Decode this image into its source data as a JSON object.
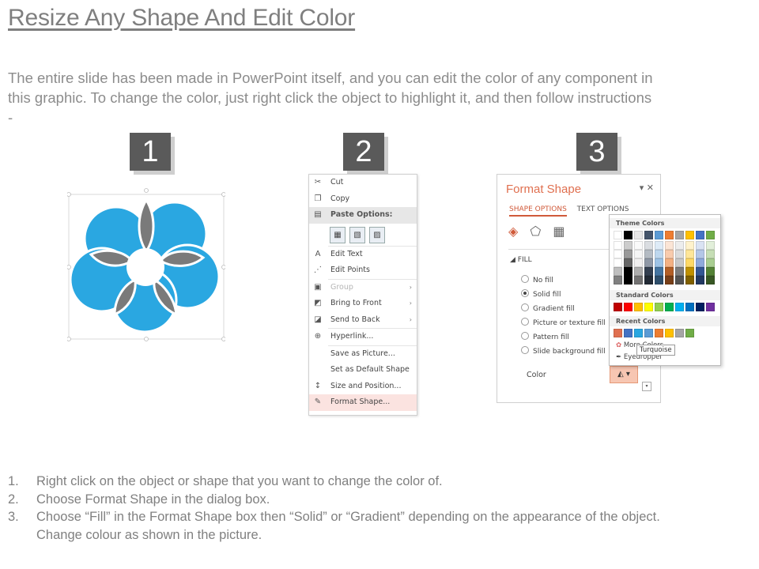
{
  "title": "Resize Any Shape And Edit Color",
  "intro": {
    "line1": "The entire slide has been made in PowerPoint itself, and you can edit the color of any component in",
    "line2": "this graphic. To change the color, just right click the object to highlight it, and then follow instructions",
    "line3": "-"
  },
  "badges": [
    "1",
    "2",
    "3"
  ],
  "colors": {
    "petal": "#2aa7e1",
    "leaf": "#7a7a7a",
    "badge": "#5a5a5a",
    "accent": "#e07050"
  },
  "context_menu": {
    "items": [
      {
        "icon": "scissors-icon",
        "glyph": "✂",
        "label": "Cut",
        "style": ""
      },
      {
        "icon": "copy-icon",
        "glyph": "❐",
        "label": "Copy",
        "style": ""
      },
      {
        "icon": "paste-icon",
        "glyph": "📋",
        "label": "Paste Options:",
        "style": "sub"
      },
      {
        "icon": "edit-text-icon",
        "glyph": "A",
        "label": "Edit Text",
        "style": ""
      },
      {
        "icon": "edit-points-icon",
        "glyph": "⋰",
        "label": "Edit Points",
        "style": ""
      },
      {
        "icon": "group-icon",
        "glyph": "▣",
        "label": "Group",
        "style": "dis",
        "arrow": "›"
      },
      {
        "icon": "bring-to-front-icon",
        "glyph": "◩",
        "label": "Bring to Front",
        "style": "",
        "arrow": "›"
      },
      {
        "icon": "send-to-back-icon",
        "glyph": "◪",
        "label": "Send to Back",
        "style": "",
        "arrow": "›"
      },
      {
        "icon": "hyperlink-icon",
        "glyph": "🌐",
        "label": "Hyperlink...",
        "style": ""
      },
      {
        "icon": "",
        "glyph": "",
        "label": "Save as Picture...",
        "style": ""
      },
      {
        "icon": "",
        "glyph": "",
        "label": "Set as Default Shape",
        "style": ""
      },
      {
        "icon": "size-position-icon",
        "glyph": "↕",
        "label": "Size and Position...",
        "style": ""
      },
      {
        "icon": "format-shape-icon",
        "glyph": "✎",
        "label": "Format Shape...",
        "style": "hl"
      }
    ]
  },
  "format_pane": {
    "title": "Format Shape",
    "tab_active": "SHAPE OPTIONS",
    "tab_other": "TEXT OPTIONS",
    "section": "FILL",
    "options": [
      {
        "label": "No fill",
        "checked": false
      },
      {
        "label": "Solid fill",
        "checked": true
      },
      {
        "label": "Gradient fill",
        "checked": false
      },
      {
        "label": "Picture or texture fill",
        "checked": false
      },
      {
        "label": "Pattern fill",
        "checked": false
      },
      {
        "label": "Slide background fill",
        "checked": false
      }
    ],
    "color_label": "Color"
  },
  "palette": {
    "theme_label": "Theme Colors",
    "standard_label": "Standard Colors",
    "recent_label": "Recent Colors",
    "more_colors": "More Colors...",
    "eyedropper": "Eyedropper",
    "tooltip": "Turquoise",
    "theme_top": [
      "#ffffff",
      "#000000",
      "#e7e6e6",
      "#44546a",
      "#5b9bd5",
      "#ed7d31",
      "#a5a5a5",
      "#ffc000",
      "#4472c4",
      "#70ad47"
    ],
    "standard": [
      "#c00000",
      "#ff0000",
      "#ffc000",
      "#ffff00",
      "#92d050",
      "#00b050",
      "#00b0f0",
      "#0070c0",
      "#002060",
      "#7030a0"
    ],
    "recent": [
      "#e07050",
      "#4472c4",
      "#2aa7e1",
      "#5b9bd5",
      "#ed7d31",
      "#ffc000",
      "#a5a5a5",
      "#70ad47"
    ]
  },
  "steps": [
    {
      "num": "1.",
      "text": "Right click on the object or shape that you want to change the color of."
    },
    {
      "num": "2.",
      "text": "Choose Format Shape in the dialog box."
    },
    {
      "num": "3.",
      "text": "Choose “Fill” in the Format Shape box then “Solid” or “Gradient” depending on the appearance of the object."
    },
    {
      "num": "",
      "text": "Change colour as shown in the picture."
    }
  ]
}
